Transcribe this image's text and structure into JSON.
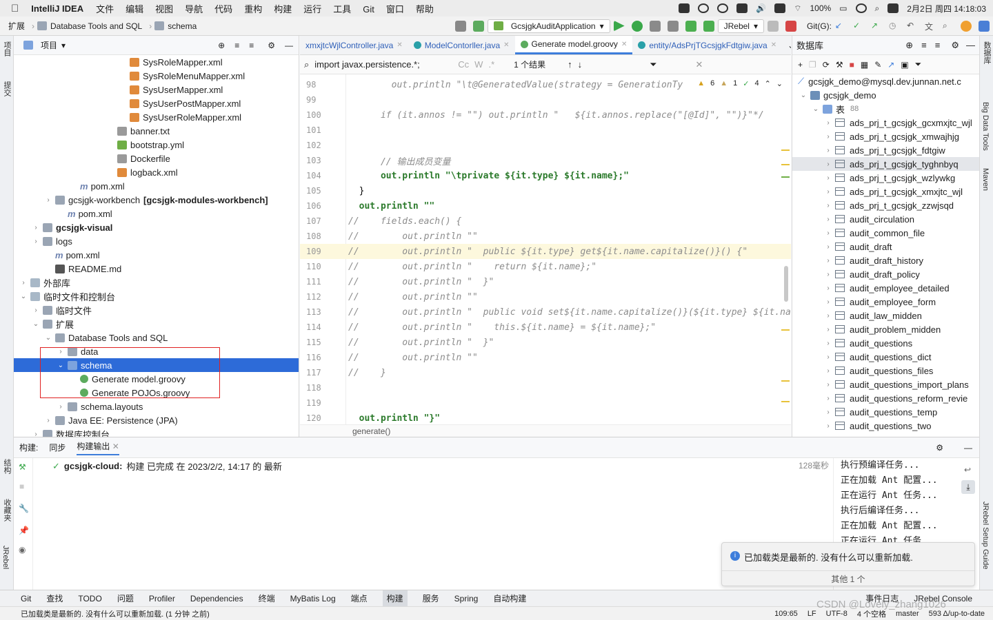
{
  "menubar": {
    "app_name": "IntelliJ IDEA",
    "menus": [
      "文件",
      "编辑",
      "视图",
      "导航",
      "代码",
      "重构",
      "构建",
      "运行",
      "工具",
      "Git",
      "窗口",
      "帮助"
    ],
    "battery": "100%",
    "datetime": "2月2日 周四  14:18:03"
  },
  "toolbar": {
    "breadcrumb": [
      "扩展",
      "Database Tools and SQL",
      "schema"
    ],
    "run_config": "GcsjgkAuditApplication",
    "jrebel": "JRebel",
    "git_label": "Git(G):"
  },
  "leftstrip": {
    "top_label": "项目",
    "mid_label": "提交",
    "struct_label": "结构",
    "fav_label": "收藏夹",
    "jrebel_label": "JRebel"
  },
  "rightstrip": {
    "db_label": "数据库",
    "bdt_label": "Big Data Tools",
    "maven_label": "Maven",
    "jrebel_guide": "JRebel Setup Guide"
  },
  "project": {
    "title": "项目",
    "rows": [
      {
        "label": "SysRoleMapper.xml",
        "type": "xml",
        "indent": 8,
        "chev": ""
      },
      {
        "label": "SysRoleMenuMapper.xml",
        "type": "xml",
        "indent": 8,
        "chev": ""
      },
      {
        "label": "SysUserMapper.xml",
        "type": "xml",
        "indent": 8,
        "chev": ""
      },
      {
        "label": "SysUserPostMapper.xml",
        "type": "xml",
        "indent": 8,
        "chev": ""
      },
      {
        "label": "SysUserRoleMapper.xml",
        "type": "xml",
        "indent": 8,
        "chev": ""
      },
      {
        "label": "banner.txt",
        "type": "txt",
        "indent": 7,
        "chev": ""
      },
      {
        "label": "bootstrap.yml",
        "type": "yml",
        "indent": 7,
        "chev": ""
      },
      {
        "label": "Dockerfile",
        "type": "txt",
        "indent": 7,
        "chev": ""
      },
      {
        "label": "logback.xml",
        "type": "xml",
        "indent": 7,
        "chev": ""
      },
      {
        "label": "pom.xml",
        "type": "mvn",
        "indent": 4,
        "chev": ""
      },
      {
        "label": "gcsjgk-workbench",
        "extra": "[gcsjgk-modules-workbench]",
        "type": "folder",
        "indent": 2,
        "chev": "›"
      },
      {
        "label": "pom.xml",
        "type": "mvn",
        "indent": 3,
        "chev": ""
      },
      {
        "label": "gcsjgk-visual",
        "type": "folder",
        "indent": 1,
        "chev": "›",
        "bold": true
      },
      {
        "label": "logs",
        "type": "folder",
        "indent": 1,
        "chev": "›"
      },
      {
        "label": "pom.xml",
        "type": "mvn",
        "indent": 2,
        "chev": ""
      },
      {
        "label": "README.md",
        "type": "md",
        "indent": 2,
        "chev": ""
      },
      {
        "label": "外部库",
        "type": "lib",
        "indent": 0,
        "chev": "›"
      },
      {
        "label": "临时文件和控制台",
        "type": "lib",
        "indent": 0,
        "chev": "⌄"
      },
      {
        "label": "临时文件",
        "type": "folder",
        "indent": 1,
        "chev": "›"
      },
      {
        "label": "扩展",
        "type": "folder",
        "indent": 1,
        "chev": "⌄"
      },
      {
        "label": "Database Tools and SQL",
        "type": "folder",
        "indent": 2,
        "chev": "⌄"
      },
      {
        "label": "data",
        "type": "folder",
        "indent": 3,
        "chev": "›"
      },
      {
        "label": "schema",
        "type": "folder",
        "indent": 3,
        "chev": "⌄",
        "selected": true
      },
      {
        "label": "Generate model.groovy",
        "type": "groovy",
        "indent": 4,
        "chev": ""
      },
      {
        "label": "Generate POJOs.groovy",
        "type": "groovy",
        "indent": 4,
        "chev": ""
      },
      {
        "label": "schema.layouts",
        "type": "folder",
        "indent": 3,
        "chev": "›"
      },
      {
        "label": "Java EE: Persistence (JPA)",
        "type": "folder",
        "indent": 2,
        "chev": "›"
      },
      {
        "label": "数据库控制台",
        "type": "folder",
        "indent": 1,
        "chev": "›"
      }
    ]
  },
  "editor": {
    "tabs": [
      {
        "label": "xmxjtcWjlController.java",
        "color": "#3d7ddb",
        "active": false
      },
      {
        "label": "ModelContorller.java",
        "color": "#2aa0a8",
        "active": false
      },
      {
        "label": "Generate model.groovy",
        "color": "#5cab5e",
        "active": true
      },
      {
        "label": "entity/AdsPrjTGcsjgkFdtgiw.java",
        "color": "#2aa0a8",
        "active": false
      }
    ],
    "find_text": "import javax.persistence.*;",
    "find_result": "1 个结果",
    "inspect": {
      "warn": "6",
      "weak": "1",
      "ok": "4"
    },
    "lines": [
      {
        "n": "98",
        "t": "        out.println \"\\t@GeneratedValue(strategy = GenerationTy",
        "cls": "cmt"
      },
      {
        "n": "99",
        "t": "",
        "cls": "plain"
      },
      {
        "n": "100",
        "t": "      if (it.annos != \"\") out.println \"   ${it.annos.replace(\"[@Id]\", \"\")}\"*/",
        "cls": "cmt"
      },
      {
        "n": "101",
        "t": "",
        "cls": "plain"
      },
      {
        "n": "102",
        "t": "",
        "cls": "plain"
      },
      {
        "n": "103",
        "t": "      // 输出成员变量",
        "cls": "cmt"
      },
      {
        "n": "104",
        "t": "      out.println \"\\tprivate ${it.type} ${it.name};\"",
        "cls": "str"
      },
      {
        "n": "105",
        "t": "  }",
        "cls": "plain"
      },
      {
        "n": "106",
        "t": "  out.println \"\"",
        "cls": "str"
      },
      {
        "n": "107",
        "t": "//    fields.each() {",
        "cls": "cmt"
      },
      {
        "n": "108",
        "t": "//        out.println \"\"",
        "cls": "cmt"
      },
      {
        "n": "109",
        "t": "//        out.println \"  public ${it.type} get${it.name.capitalize()}() {\"",
        "cls": "cmt",
        "hl": true
      },
      {
        "n": "110",
        "t": "//        out.println \"    return ${it.name};\"",
        "cls": "cmt"
      },
      {
        "n": "111",
        "t": "//        out.println \"  }\"",
        "cls": "cmt"
      },
      {
        "n": "112",
        "t": "//        out.println \"\"",
        "cls": "cmt"
      },
      {
        "n": "113",
        "t": "//        out.println \"  public void set${it.name.capitalize()}(${it.type} ${it.na",
        "cls": "cmt"
      },
      {
        "n": "114",
        "t": "//        out.println \"    this.${it.name} = ${it.name};\"",
        "cls": "cmt"
      },
      {
        "n": "115",
        "t": "//        out.println \"  }\"",
        "cls": "cmt"
      },
      {
        "n": "116",
        "t": "//        out.println \"\"",
        "cls": "cmt"
      },
      {
        "n": "117",
        "t": "//    }",
        "cls": "cmt"
      },
      {
        "n": "118",
        "t": "",
        "cls": "plain"
      },
      {
        "n": "119",
        "t": "",
        "cls": "plain"
      },
      {
        "n": "120",
        "t": "  out.println \"}\"",
        "cls": "str"
      }
    ],
    "breadcrumb": "generate()"
  },
  "database": {
    "title": "数据库",
    "connection": "gcsjgk_demo@mysql.dev.junnan.net.c",
    "schema": "gcsjgk_demo",
    "tables_label": "表",
    "tables_count": "88",
    "tables": [
      "ads_prj_t_gcsjgk_gcxmxjtc_wjl",
      "ads_prj_t_gcsjgk_xmwajhjg",
      "ads_prj_t_gcsjgk_fdtgiw",
      "ads_prj_t_gcsjgk_tyghnbyq",
      "ads_prj_t_gcsjgk_wzlywkg",
      "ads_prj_t_gcsjgk_xmxjtc_wjl",
      "ads_prj_t_gcsjgk_zzwjsqd",
      "audit_circulation",
      "audit_common_file",
      "audit_draft",
      "audit_draft_history",
      "audit_draft_policy",
      "audit_employee_detailed",
      "audit_employee_form",
      "audit_law_midden",
      "audit_problem_midden",
      "audit_questions",
      "audit_questions_dict",
      "audit_questions_files",
      "audit_questions_import_plans",
      "audit_questions_reform_revie",
      "audit_questions_temp",
      "audit_questions_two"
    ],
    "selected_index": 3
  },
  "build": {
    "label": "构建:",
    "tab_sync": "同步",
    "tab_output": "构建输出",
    "project": "gcsjgk-cloud:",
    "message": "构建 已完成 在 2023/2/2, 14:17 的 最新",
    "duration": "128毫秒",
    "output": [
      "执行预编译任务...",
      "正在加载 Ant 配置...",
      "正在运行 Ant 任务...",
      "执行后编译任务...",
      "正在加载 Ant 配置...",
      "正在运行 Ant 任务..."
    ],
    "notification": "已加载类是最新的. 没有什么可以重新加载.",
    "notification_more": "其他 1 个"
  },
  "toolwindows": [
    "Git",
    "查找",
    "TODO",
    "问题",
    "Profiler",
    "Dependencies",
    "终端",
    "MyBatis Log",
    "端点",
    "构建",
    "服务",
    "Spring",
    "自动构建"
  ],
  "toolwindows_right": [
    "事件日志",
    "JRebel Console"
  ],
  "status": {
    "message": "已加载类是最新的. 没有什么可以重新加载. (1 分钟 之前)",
    "position": "109:65",
    "line_sep": "LF",
    "encoding": "UTF-8",
    "indent": "4 个空格",
    "branch": "master",
    "memory": "593 Δ/up-to-date",
    "watermark": "CSDN @Lovely_zhang1026"
  }
}
